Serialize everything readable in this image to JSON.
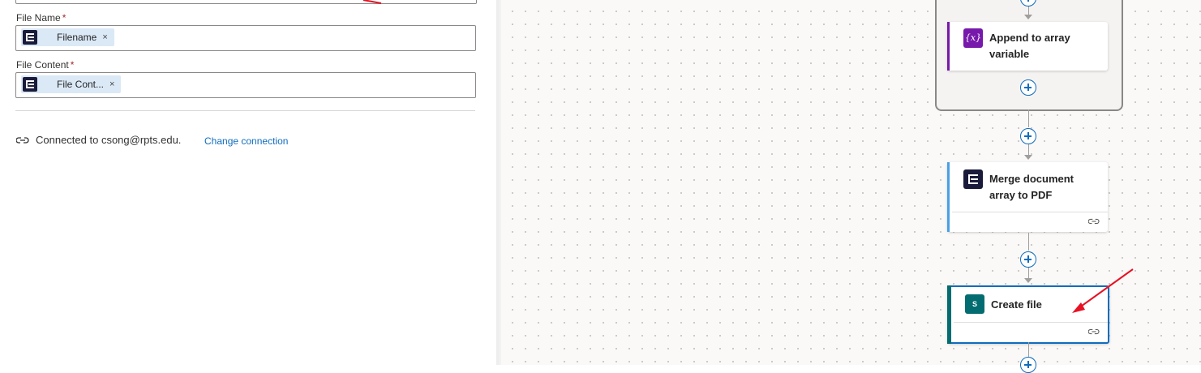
{
  "properties": {
    "file_name": {
      "label": "File Name",
      "required_mark": "*",
      "token": "Filename",
      "remove": "×"
    },
    "file_content": {
      "label": "File Content",
      "required_mark": "*",
      "token": "File Cont...",
      "remove": "×"
    },
    "connection": {
      "text": "Connected to csong@rpts.edu.",
      "change_label": "Change connection"
    }
  },
  "canvas": {
    "actions": [
      {
        "title_line1": "Append to array",
        "title_line2": "variable",
        "icon": "variable-icon",
        "icon_glyph": "{x}",
        "accent": "#7719aa"
      },
      {
        "title_line1": "Merge document",
        "title_line2": "array to PDF",
        "icon": "encodian-icon",
        "accent": "#4aa0e6"
      },
      {
        "title_line1": "Create file",
        "icon": "sharepoint-icon",
        "icon_glyph": "S",
        "accent": "#036c70"
      }
    ]
  },
  "colors": {
    "link": "#0f6cbd",
    "annotation": "#e81123",
    "selected_border": "#0f6cbd"
  }
}
